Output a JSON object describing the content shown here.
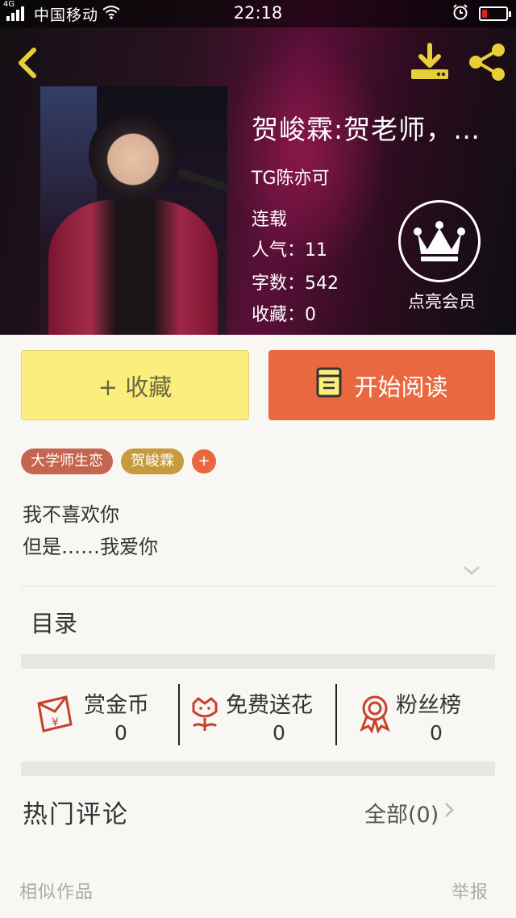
{
  "status_bar": {
    "network": "4G",
    "carrier": "中国移动",
    "time": "22:18"
  },
  "book": {
    "title": "贺峻霖:贺老师，…",
    "author": "TG陈亦可",
    "status": "连载",
    "popularity": "人气：11",
    "word_count": "字数：542",
    "favorites": "收藏：0",
    "vip_label": "点亮会员"
  },
  "actions": {
    "favorite_label": "+ 收藏",
    "read_label": "开始阅读"
  },
  "tags": [
    "大学师生恋",
    "贺峻霖"
  ],
  "tag_add": "+",
  "description": {
    "line1": "我不喜欢你",
    "line2": "但是……我爱你"
  },
  "toc_label": "目录",
  "stats": [
    {
      "label": "赏金币",
      "value": "0",
      "icon": "red-envelope-icon"
    },
    {
      "label": "免费送花",
      "value": "0",
      "icon": "flower-icon"
    },
    {
      "label": "粉丝榜",
      "value": "0",
      "icon": "medal-icon"
    }
  ],
  "comments": {
    "title": "热门评论",
    "all_label": "全部(0)"
  },
  "footer": {
    "similar": "相似作品",
    "report": "举报"
  },
  "colors": {
    "accent_orange": "#ea683f",
    "fav_yellow": "#fbee7c",
    "tag_red": "#c4654f",
    "tag_gold": "#c79a3e",
    "icon_gold": "#e8cf3a"
  }
}
